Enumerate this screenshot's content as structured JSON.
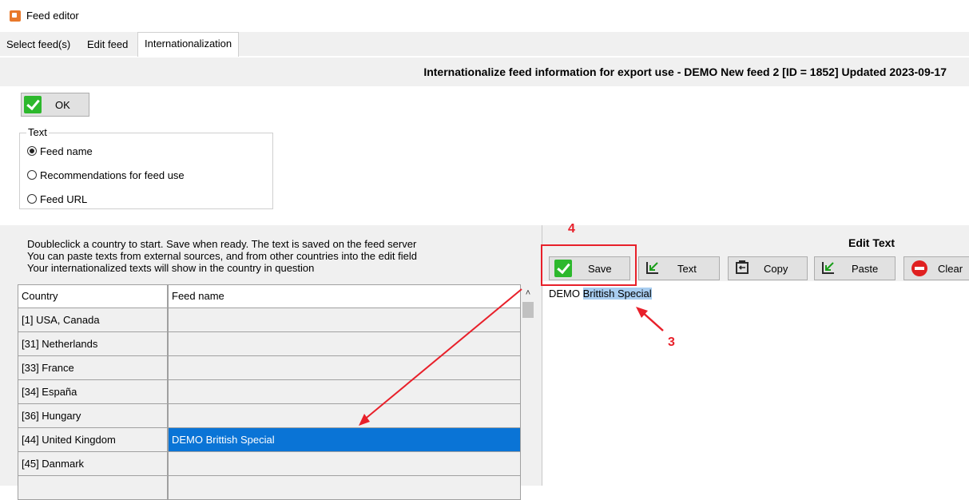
{
  "window": {
    "title": "Feed editor"
  },
  "tabs": [
    {
      "label": "Select feed(s)"
    },
    {
      "label": "Edit feed"
    },
    {
      "label": "Internationalization",
      "active": true
    }
  ],
  "header": {
    "text": "Internationalize feed information for export use - DEMO New feed 2 [ID = 1852] Updated 2023-09-17"
  },
  "ok_button": {
    "label": "OK"
  },
  "text_group": {
    "label": "Text",
    "options": [
      {
        "label": "Feed name",
        "selected": true
      },
      {
        "label": "Recommendations for feed use",
        "selected": false
      },
      {
        "label": "Feed URL",
        "selected": false
      }
    ]
  },
  "info_lines": [
    "Doubleclick a country to start. Save when ready. The text is saved on the feed server",
    "You can paste texts from external sources, and from other countries into the edit field",
    "Your internationalized texts will show in the country in question"
  ],
  "grid": {
    "columns": [
      "Country",
      "Feed name"
    ],
    "rows": [
      {
        "country": "[1] USA, Canada",
        "feed_name": ""
      },
      {
        "country": "[31] Netherlands",
        "feed_name": ""
      },
      {
        "country": "[33] France",
        "feed_name": ""
      },
      {
        "country": "[34] España",
        "feed_name": ""
      },
      {
        "country": "[36] Hungary",
        "feed_name": ""
      },
      {
        "country": "[44] United Kingdom",
        "feed_name": "DEMO Brittish Special",
        "selected": true
      },
      {
        "country": "[45] Danmark",
        "feed_name": ""
      },
      {
        "country": "",
        "feed_name": ""
      }
    ]
  },
  "edit_panel": {
    "title": "Edit Text",
    "buttons": {
      "save": "Save",
      "text": "Text",
      "copy": "Copy",
      "paste": "Paste",
      "clear": "Clear"
    },
    "content_prefix": "DEMO ",
    "content_selected": "Brittish Special"
  },
  "annotations": {
    "step3": "3",
    "step4": "4"
  },
  "colors": {
    "accent_selection": "#0a74d6",
    "annotation_red": "#e8202a",
    "check_green": "#2db82d"
  }
}
